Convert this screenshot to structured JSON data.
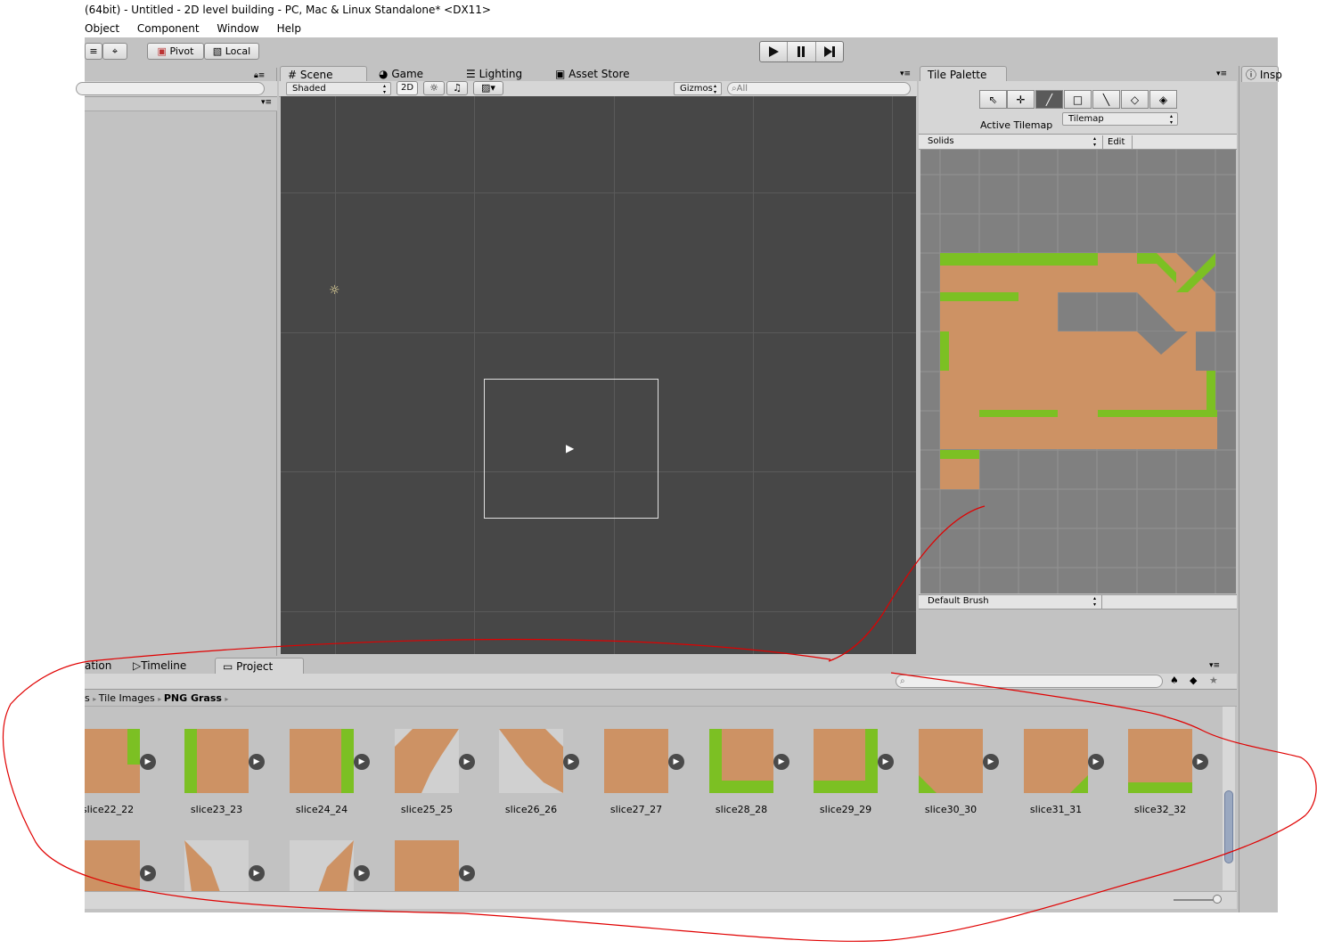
{
  "window": {
    "title": "(64bit) - Untitled - 2D level building - PC, Mac & Linux Standalone* <DX11>"
  },
  "menu": [
    "Object",
    "Component",
    "Window",
    "Help"
  ],
  "toolbar": {
    "pivot_label": "Pivot",
    "local_label": "Local"
  },
  "scene_tabs": {
    "scene": "Scene",
    "game": "Game",
    "lighting": "Lighting",
    "asset_store": "Asset Store"
  },
  "scene_bar": {
    "shading": "Shaded",
    "mode_2d": "2D",
    "gizmos": "Gizmos",
    "search_placeholder": "All"
  },
  "tile_palette": {
    "tab_label": "Tile Palette",
    "active_tilemap_label": "Active Tilemap",
    "active_tilemap_value": "Tilemap",
    "palette_name": "Solids",
    "edit_label": "Edit",
    "brush_name": "Default Brush"
  },
  "inspector": {
    "tab_label": "Insp"
  },
  "bottom_tabs": {
    "animation": "ation",
    "timeline": "Timeline",
    "project": "Project"
  },
  "breadcrumb": [
    "s",
    "Tile Images",
    "PNG Grass"
  ],
  "assets": [
    {
      "name": "slice22_22"
    },
    {
      "name": "slice23_23"
    },
    {
      "name": "slice24_24"
    },
    {
      "name": "slice25_25"
    },
    {
      "name": "slice26_26"
    },
    {
      "name": "slice27_27"
    },
    {
      "name": "slice28_28"
    },
    {
      "name": "slice29_29"
    },
    {
      "name": "slice30_30"
    },
    {
      "name": "slice31_31"
    },
    {
      "name": "slice32_32"
    }
  ],
  "colors": {
    "editor_bg": "#c2c2c2",
    "scene_bg": "#474747",
    "dirt": "#cd9264",
    "grass": "#7cc023",
    "annotation": "#e00000"
  }
}
